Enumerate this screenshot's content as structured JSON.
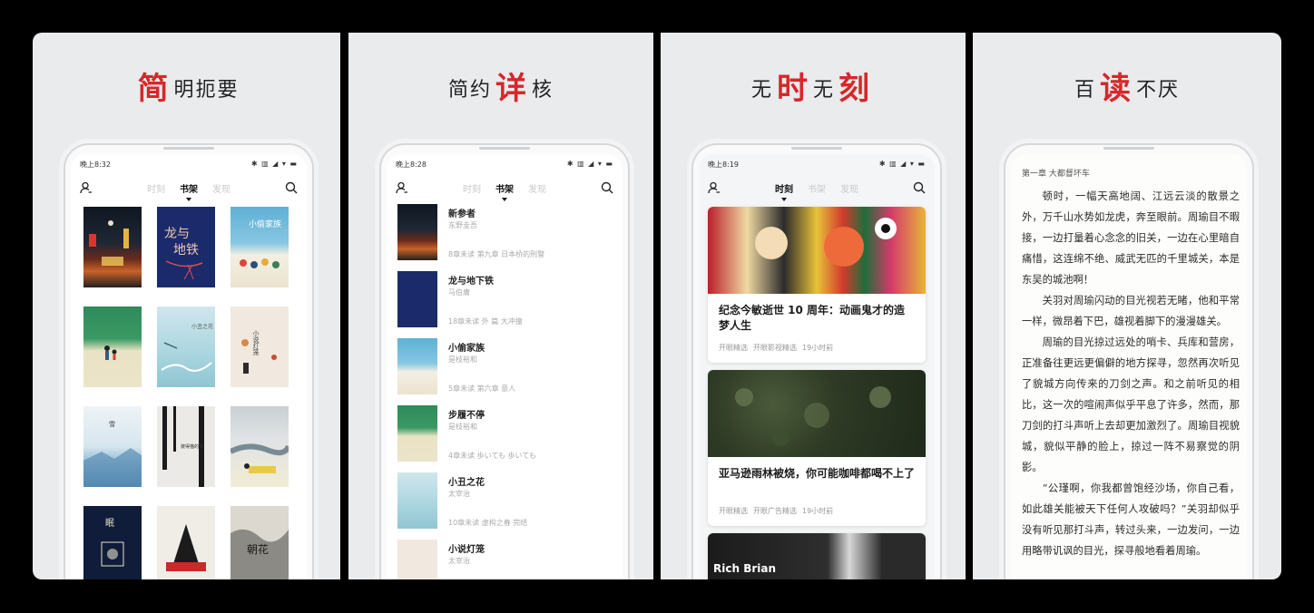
{
  "panels": [
    {
      "headline": {
        "hl": "简",
        "rest": "明扼要"
      },
      "phone": {
        "time": "晚上8:32",
        "status_icons": "✱ ▥ ◢ ▾ ▬",
        "tabs": [
          "时刻",
          "书架",
          "发现"
        ],
        "active_tab": 1
      }
    },
    {
      "headline": {
        "pre": "简约",
        "hl": "详",
        "rest": "核"
      },
      "phone": {
        "time": "晚上8:28",
        "status_icons": "✱ ▥ ◢ ▾ ▬",
        "tabs": [
          "时刻",
          "书架",
          "发现"
        ],
        "active_tab": 1
      },
      "books": [
        {
          "title": "新参者",
          "author": "东野圭吾",
          "progress": "8章未读  第九章 日本桥的刑警"
        },
        {
          "title": "龙与地下铁",
          "author": "马伯庸",
          "progress": "18章未读  外 篇 大冲撞"
        },
        {
          "title": "小偷家族",
          "author": "是枝裕和",
          "progress": "5章未读  第六章 意人"
        },
        {
          "title": "步履不停",
          "author": "是枝裕和",
          "progress": "4章未读  歩いても 歩いても"
        },
        {
          "title": "小丑之花",
          "author": "太宰治",
          "progress": "10章未读  虚构之春 完结"
        },
        {
          "title": "小说灯笼",
          "author": "太宰治",
          "progress": ""
        }
      ]
    },
    {
      "headline": {
        "pre": "无",
        "hl": "时",
        "mid": "无",
        "hl2": "刻"
      },
      "phone": {
        "time": "晚上8:19",
        "status_icons": "✱ ▥ ◢ ▾ ▬",
        "tabs": [
          "时刻",
          "书架",
          "发现"
        ],
        "active_tab": 0
      },
      "articles": [
        {
          "title": "纪念今敏逝世 10 周年：动画鬼才的造梦人生",
          "meta": [
            "开眼精选",
            "开眼影视精选",
            "19小时前"
          ]
        },
        {
          "title": "亚马逊雨林被烧，你可能咖啡都喝不上了",
          "meta": [
            "开眼精选",
            "开眼广告精选",
            "19小时前"
          ]
        },
        {
          "overlay": "Rich Brian"
        }
      ]
    },
    {
      "headline": {
        "pre": "百",
        "hl": "读",
        "rest": "不厌"
      },
      "reader": {
        "chapter": "第一章 大都督坏车",
        "paragraphs": [
          "顿时，一幅天高地阔、江远云淡的散景之外，万千山水势如龙虎，奔至眼前。周瑜目不暇接，一边打量着心念念的旧关，一边在心里暗自痛惜，这连绵不绝、威武无匹的千里城关，本是东吴的城池啊！",
          "关羽对周瑜闪动的目光视若无睹，他和平常一样，微昂着下巴，雄视着脚下的漫漫雄关。",
          "周瑜的目光掠过远处的哨卡、兵库和营房，正准备往更远更偏僻的地方探寻，忽然再次听见了貌城方向传来的刀剑之声。和之前听见的相比，这一次的喧闹声似乎平息了许多，然而，那刀剑的打斗声听上去却更加激烈了。周瑜目视貌城，貌似平静的脸上，掠过一阵不易察觉的阴影。",
          "“公瑾啊，你我都曾饱经沙场，你自己看，如此雄关能被天下任何人攻破吗？”关羽却似乎没有听见那打斗声，转过头来，一边发问，一边用略带讥讽的目光，探寻般地看着周瑜。"
        ]
      }
    }
  ],
  "colors": {
    "accent": "#d6282b",
    "panel_bg": "#e9ebed"
  }
}
